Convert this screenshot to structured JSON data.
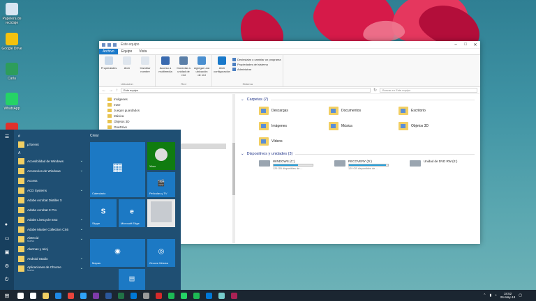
{
  "desktop": {
    "icons": [
      {
        "label": "Papelera de reciclaje",
        "icon": "recycle-bin-icon",
        "color": "#d8e6f2"
      },
      {
        "label": "Google Drive",
        "icon": "google-drive-icon",
        "color": "#f4c20d"
      },
      {
        "label": "Carla",
        "icon": "app-icon",
        "color": "#2d9d5b"
      },
      {
        "label": "WhatsApp",
        "icon": "whatsapp-icon",
        "color": "#25d366"
      },
      {
        "label": "",
        "icon": "power-icon",
        "color": "#e2312b"
      }
    ]
  },
  "explorer": {
    "title": "Este equipo",
    "tabs": [
      "Archivo",
      "Equipo",
      "Vista"
    ],
    "active_tab": "Archivo",
    "ribbon": {
      "groups": [
        {
          "name": "Ubicación",
          "buttons": [
            "Propiedades",
            "Abrir",
            "Cambiar nombre"
          ]
        },
        {
          "name": "Red",
          "buttons": [
            "Acceso a multimedia",
            "Conectar a unidad de red",
            "Agregar una ubicación de red"
          ]
        },
        {
          "name": "Sistema",
          "buttons": [
            "Abrir configuración"
          ]
        }
      ],
      "system_list": [
        "Desinstalar o cambiar un programa",
        "Propiedades del sistema",
        "Administrar"
      ]
    },
    "address": "Este equipo",
    "search_placeholder": "Buscar en Este equipo",
    "nav_items": [
      "Imágenes",
      "mwe",
      "Juegos guardados",
      "Música",
      "Objetos 3D",
      "OneDrive"
    ],
    "sections": {
      "folders_title": "Carpetas (7)",
      "drives_title": "Dispositivos y unidades (3)"
    },
    "folders": [
      "Descargas",
      "Documentos",
      "Escritorio",
      "Imágenes",
      "Música",
      "Objetos 3D",
      "Vídeos"
    ],
    "drives": [
      {
        "name": "WINDOWS (C:)",
        "space": "129 GB disponibles de ...",
        "fill": 0.62
      },
      {
        "name": "RECOVERY (D:)",
        "space": "129 GB disponibles de ...",
        "fill": 0.95
      },
      {
        "name": "Unidad de DVD RW (E:)",
        "space": "",
        "fill": null
      }
    ]
  },
  "start_menu": {
    "tiles_header": "Crear",
    "apps": [
      {
        "label": "#",
        "type": "letter"
      },
      {
        "label": "µTorrent",
        "sub": "",
        "chevron": false
      },
      {
        "label": "A",
        "type": "letter"
      },
      {
        "label": "Accesibilidad de Windows",
        "chevron": true
      },
      {
        "label": "Accesorios de Windows",
        "chevron": true
      },
      {
        "label": "Access",
        "chevron": false
      },
      {
        "label": "ACD Systems",
        "chevron": true
      },
      {
        "label": "Adobe Acrobat Distiller X",
        "chevron": false
      },
      {
        "label": "Adobe Acrobat X Pro",
        "chevron": false
      },
      {
        "label": "Adobe LiveCycle ES2",
        "chevron": true
      },
      {
        "label": "Adobe Master Collection CS6",
        "chevron": true
      },
      {
        "label": "AirDroid",
        "sub": "Nuevo",
        "chevron": true
      },
      {
        "label": "Alarmas y reloj",
        "chevron": false
      },
      {
        "label": "Android Studio",
        "chevron": true
      },
      {
        "label": "Aplicaciones de Chrome",
        "sub": "Nuevo",
        "chevron": true
      }
    ],
    "tiles": {
      "calendar": "Calendario",
      "xbox": "Xbox",
      "movies": "Películas y TV",
      "skype": "Skype",
      "edge": "Microsoft Edge",
      "maps": "Mapas",
      "groove": "Groove Música"
    }
  },
  "taskbar": {
    "time": "18:52",
    "date": "26-May-18",
    "icons": [
      {
        "name": "search-icon",
        "color": "#ffffff"
      },
      {
        "name": "task-view-icon",
        "color": "#ffffff"
      },
      {
        "name": "file-explorer-icon",
        "color": "#f2cf63"
      },
      {
        "name": "edge-icon",
        "color": "#1e88e5"
      },
      {
        "name": "chrome-icon",
        "color": "#e8453c"
      },
      {
        "name": "photoshop-icon",
        "color": "#2fa3f7"
      },
      {
        "name": "onenote-icon",
        "color": "#7e3ba9"
      },
      {
        "name": "word-icon",
        "color": "#2b579a"
      },
      {
        "name": "excel-icon",
        "color": "#217346"
      },
      {
        "name": "store-icon",
        "color": "#0078d7"
      },
      {
        "name": "calculator-icon",
        "color": "#9a9a9a"
      },
      {
        "name": "opera-icon",
        "color": "#d62a2a"
      },
      {
        "name": "spotify-icon",
        "color": "#1db954"
      },
      {
        "name": "whatsapp-icon",
        "color": "#25d366"
      },
      {
        "name": "spotify-icon",
        "color": "#1db954"
      },
      {
        "name": "mail-icon",
        "color": "#0078d7"
      },
      {
        "name": "maps-icon",
        "color": "#7cc"
      },
      {
        "name": "unknown-icon",
        "color": "#a25"
      }
    ]
  }
}
